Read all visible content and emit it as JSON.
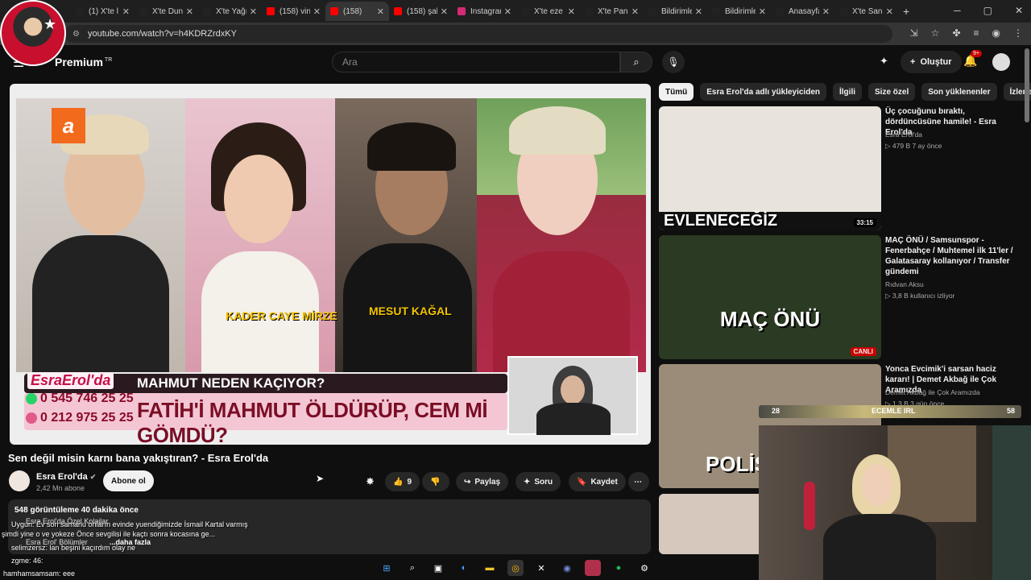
{
  "browser": {
    "tabs": [
      {
        "label": "(1) X'te l",
        "favicon_color": "#222222"
      },
      {
        "label": "X'te Dun",
        "favicon_color": "#222222"
      },
      {
        "label": "X'te Yağı",
        "favicon_color": "#222222"
      },
      {
        "label": "(158) vin",
        "favicon_color": "#ff0000"
      },
      {
        "label": "(158)",
        "favicon_color": "#ff0000"
      },
      {
        "label": "(158) şal",
        "favicon_color": "#ff0000"
      },
      {
        "label": "Instagram",
        "favicon_color": "#d62976"
      },
      {
        "label": "X'te eze",
        "favicon_color": "#222222"
      },
      {
        "label": "X'te Pan",
        "favicon_color": "#222222"
      },
      {
        "label": "Bildirimle",
        "favicon_color": "#222222"
      },
      {
        "label": "Bildirimle",
        "favicon_color": "#222222"
      },
      {
        "label": "Anasayfa",
        "favicon_color": "#222222"
      },
      {
        "label": "X'te San",
        "favicon_color": "#222222"
      }
    ],
    "active_tab": 4,
    "url": "youtube.com/watch?v=h4KDRZrdxKY"
  },
  "youtube": {
    "logo": "Premium",
    "logo_sup": "TR",
    "search_placeholder": "Ara",
    "create_label": "Oluştur",
    "notif_count": "9+"
  },
  "video": {
    "panel_labels": [
      "KADER CAYE MİRZE",
      "MESUT KAĞAL"
    ],
    "lower_third_top": "MAHMUT NEDEN KAÇIYOR?",
    "lower_third_main": "FATİH'İ MAHMUT ÖLDÜRÜP, CEM Mİ GÖMDÜ?",
    "brand": "EsraErol'da",
    "phones": [
      "0 545 746 25 25",
      "0 212 975 25 25"
    ],
    "atv_logo": "a",
    "title": "Sen değil misin karnı bana yakıştıran? - Esra Erol'da",
    "channel_name": "Esra Erol'da",
    "channel_subs": "2,42 Mn abone",
    "subscribe_label": "Abone ol",
    "likes": "9",
    "share_label": "Paylaş",
    "ask_label": "Soru",
    "save_label": "Kaydet",
    "views_meta": "548 görüntüleme  40 dakika önce",
    "desc_line1": "Esra Erol'da Özel Kolajlar",
    "desc_line2": "Esra Erol' Bölümler",
    "more_label": "...daha fazla"
  },
  "chat_overlay": [
    "Uygun: Ev son samanu onların evinde yuendiğimizde İsmail Kartal varmış",
    "şimdi yine o ve yokeze Önce sevgilisi ile kaçtı sonra kocasına ge...",
    "selimzersz: lan beşini kaçırdım olay ne",
    "zgme: 46:",
    "hamhamsamsam: eee"
  ],
  "chips": [
    "Tümü",
    "Esra Erol'da adlı yükleyiciden",
    "İlgili",
    "Size özel",
    "Son yüklenenler",
    "İzlenenler"
  ],
  "recommendations": [
    {
      "title": "Üç çocuğunu bıraktı, dördüncüsüne hamile! - Esra Erol'da",
      "channel": "Esra Erol'da",
      "meta": "▷ 479 B  7 ay önce",
      "duration": "33:15",
      "thumb_caption": "EVLENECEĞİZ",
      "thumb_color": "#e9e3dd"
    },
    {
      "title": "MAÇ ÖNÜ / Samsunspor - Fenerbahçe / Muhtemel ilk 11'ler / Galatasaray kollanıyor / Transfer gündemi",
      "channel": "Rıdvan Aksu",
      "meta": "▷ 3,8 B kullanıcı izliyor",
      "duration": "CANLI",
      "thumb_caption": "MAÇ ÖNÜ",
      "thumb_color": "#2b3a22"
    },
    {
      "title": "Yonca Evcimik'i sarsan haciz kararı! | Demet Akbağ ile Çok Aramızda",
      "channel": "Demet Akbağ ile Çok Aramızda",
      "meta": "▷ 1,3 B  3 gün önce",
      "duration": "",
      "thumb_caption": "POLİS",
      "thumb_color": "#9a8c78"
    },
    {
      "title": "",
      "channel": "",
      "meta": "",
      "duration": "",
      "thumb_caption": "",
      "thumb_color": "#d6c8bd"
    }
  ],
  "stream_overlay": {
    "left": "28",
    "center": "ECEMLE IRL",
    "right": "58"
  }
}
